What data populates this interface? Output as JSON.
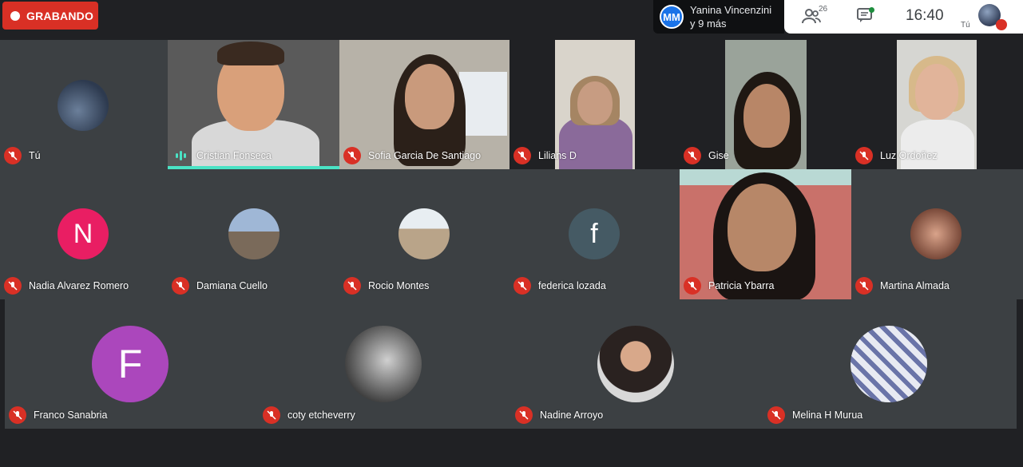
{
  "recording": {
    "label": "GRABANDO"
  },
  "presenter": {
    "initials": "MM",
    "line1": "Yanina Vincenzini",
    "line2": "y 9 más"
  },
  "toolbar": {
    "participants_count": "26",
    "time": "16:40",
    "self_label": "Tú"
  },
  "colors": {
    "record_red": "#d93025",
    "speaking_accent": "#4ae3c5",
    "tile_bg": "#3c4043",
    "page_bg": "#202124"
  },
  "participants": [
    {
      "name": "Tú"
    },
    {
      "name": "Cristian Fonseca"
    },
    {
      "name": "Sofia Garcia De Santiago"
    },
    {
      "name": "Lilians D"
    },
    {
      "name": "Gise"
    },
    {
      "name": "Luz Ordoñez"
    },
    {
      "name": "Nadia Alvarez Romero",
      "initial": "N",
      "color": "#e91e63"
    },
    {
      "name": "Damiana Cuello"
    },
    {
      "name": "Rocio Montes"
    },
    {
      "name": "federica lozada",
      "initial": "f",
      "color": "#455a64"
    },
    {
      "name": "Patricia Ybarra"
    },
    {
      "name": "Martina Almada"
    },
    {
      "name": "Franco Sanabria",
      "initial": "F",
      "color": "#ab47bc"
    },
    {
      "name": "coty etcheverry"
    },
    {
      "name": "Nadine Arroyo"
    },
    {
      "name": "Melina H Murua"
    }
  ]
}
